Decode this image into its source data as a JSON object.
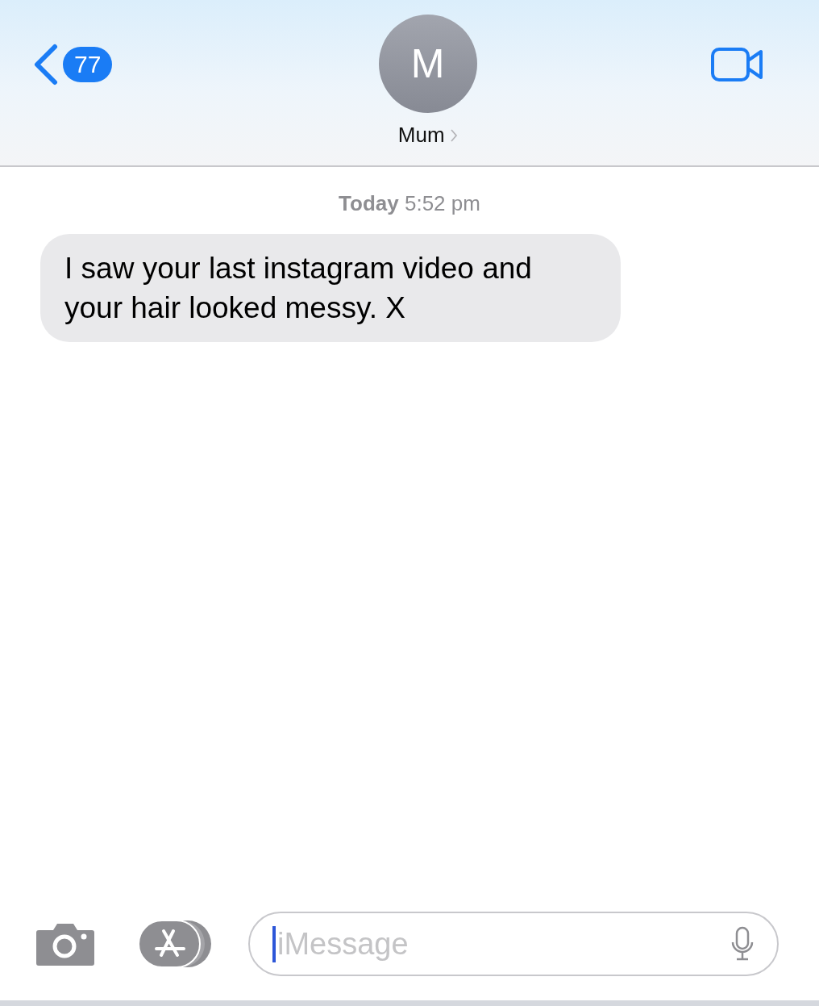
{
  "header": {
    "unread_count": "77",
    "avatar_initial": "M",
    "contact_name": "Mum"
  },
  "timestamp": "**Today** 5:52 pm",
  "messages": [
    {
      "kind": "received",
      "text": "I saw your last instagram video and your hair looked messy. X"
    }
  ],
  "composer": {
    "placeholder": "iMessage"
  }
}
